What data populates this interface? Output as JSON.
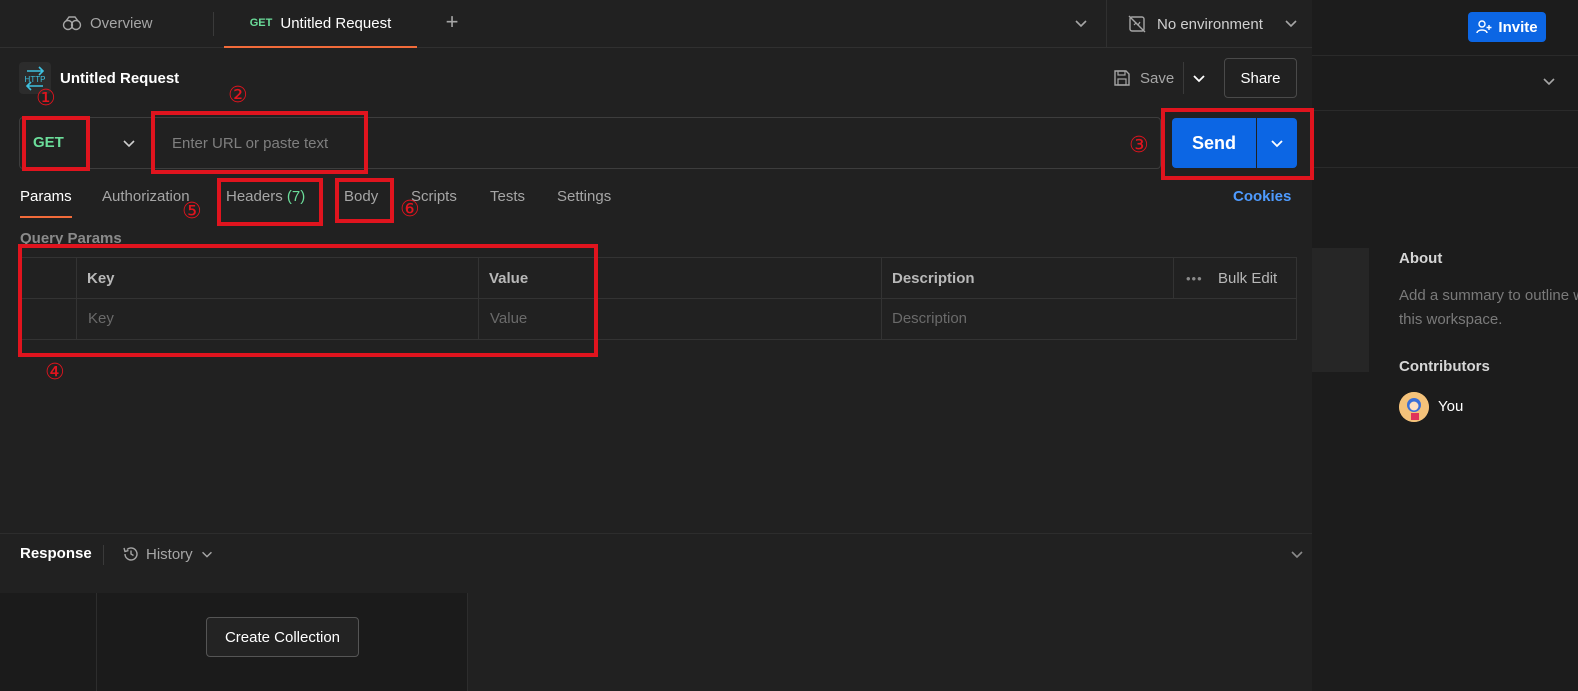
{
  "tabs": {
    "overview_label": "Overview",
    "active_method": "GET",
    "active_title": "Untitled Request",
    "plus": "+"
  },
  "environment": {
    "label": "No environment"
  },
  "right_panel": {
    "invite_label": "Invite",
    "about_heading": "About",
    "about_text_line1": "Add a summary to outline what's this",
    "about_text_line2": "this workspace.",
    "contributors_heading": "Contributors",
    "contributor_name": "You"
  },
  "request": {
    "icon_label": "HTTP",
    "title": "Untitled Request",
    "save_label": "Save",
    "share_label": "Share",
    "method": "GET",
    "url_placeholder": "Enter URL or paste text",
    "send_label": "Send"
  },
  "request_tabs": {
    "params": "Params",
    "authorization": "Authorization",
    "headers": "Headers",
    "headers_count": "(7)",
    "body": "Body",
    "scripts": "Scripts",
    "tests": "Tests",
    "settings": "Settings",
    "cookies": "Cookies"
  },
  "query_params": {
    "label": "Query Params",
    "columns": [
      "Key",
      "Value",
      "Description"
    ],
    "placeholders": [
      "Key",
      "Value",
      "Description"
    ],
    "bulk_edit": "Bulk Edit",
    "more": "•••"
  },
  "response": {
    "title": "Response",
    "history_label": "History",
    "create_collection": "Create Collection"
  },
  "annotations": [
    "①",
    "②",
    "③",
    "④",
    "⑤",
    "⑥"
  ],
  "colors": {
    "accent_blue": "#0c66e4",
    "method_green": "#6bdd9a",
    "tab_orange": "#f26b3a",
    "annotation_red": "#e0141e",
    "link_blue": "#4e9bff"
  }
}
